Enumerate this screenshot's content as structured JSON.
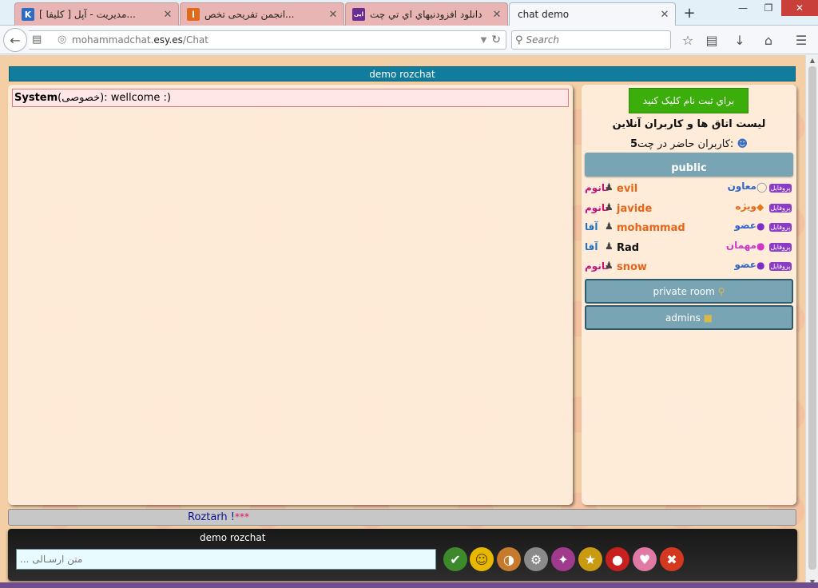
{
  "browser": {
    "tabs": [
      {
        "title": "[ کلیفا ] مدیریت - آپل...",
        "favicon": "K",
        "favicon_color": "#2c6cc4"
      },
      {
        "title": "انجمن تفریحی تخص...",
        "favicon": "ا",
        "favicon_color": "#e06a1c"
      },
      {
        "title": "دانلود افزودنيهاي اي تي چت",
        "favicon": "اپی",
        "favicon_color": "#6b2c91"
      },
      {
        "title": "chat demo",
        "favicon": "",
        "favicon_color": "#ffffff"
      }
    ],
    "url_prefix": "mohammadchat.",
    "url_domain": "esy.es",
    "url_path": "/Chat",
    "search_placeholder": "Search"
  },
  "chat": {
    "header_title": "demo rozchat",
    "messages": [
      {
        "sender": "System",
        "tag": "(خصوصی)",
        "text": ": wellcome :)"
      }
    ]
  },
  "sidebar": {
    "register_label": "براي ثبت نام كليک كنيد",
    "list_title": "لیست اتاق ها و کاربران آنلاین",
    "online_label": "کاربران حاضر در چت:",
    "online_count": "5",
    "rooms": {
      "public": "public",
      "private": "private room",
      "admins": "admins"
    },
    "users": [
      {
        "name": "evil",
        "gender": "خانوم",
        "rank": "معاون",
        "rank_color": "#2f64c8",
        "name_color": "#e5661a",
        "gender_color": "#c0147e",
        "badge": "پروفایل"
      },
      {
        "name": "javide",
        "gender": "خانوم",
        "rank": "ویژه",
        "rank_color": "#e5661a",
        "name_color": "#e5661a",
        "gender_color": "#c0147e",
        "badge": "پروفایل"
      },
      {
        "name": "mohammad",
        "gender": "آقا",
        "rank": "عضو",
        "rank_color": "#2f64c8",
        "name_color": "#e5661a",
        "gender_color": "#1f70c0",
        "badge": "پروفایل"
      },
      {
        "name": "Rad",
        "gender": "آقا",
        "rank": "مهمان",
        "rank_color": "#d036c8",
        "name_color": "#111111",
        "gender_color": "#1f70c0",
        "badge": "پروفایل"
      },
      {
        "name": "snow",
        "gender": "خانوم",
        "rank": "عضو",
        "rank_color": "#2f64c8",
        "name_color": "#e5661a",
        "gender_color": "#c0147e",
        "badge": "پروفایل"
      }
    ]
  },
  "footer": {
    "brand": "Roztarh !",
    "stars": "***"
  },
  "composer": {
    "title": "demo rozchat",
    "placeholder": "متن ارسـالی ...",
    "tools": [
      {
        "name": "send-icon",
        "color": "#3c8a2c",
        "glyph": "✔"
      },
      {
        "name": "smiley-icon",
        "color": "#e8b800",
        "glyph": "☺"
      },
      {
        "name": "palette-icon",
        "color": "#c57a2d",
        "glyph": "🎨"
      },
      {
        "name": "gear-icon",
        "color": "#8a8a8a",
        "glyph": "⚙"
      },
      {
        "name": "magic-wand-icon",
        "color": "#a03a8c",
        "glyph": "✨"
      },
      {
        "name": "trophy-icon",
        "color": "#c99a12",
        "glyph": "🏆"
      },
      {
        "name": "angry-bird-icon",
        "color": "#c8201e",
        "glyph": "●"
      },
      {
        "name": "heart-icon",
        "color": "#e07aa5",
        "glyph": "♥"
      },
      {
        "name": "close-icon",
        "color": "#d4391f",
        "glyph": "✖"
      }
    ]
  }
}
